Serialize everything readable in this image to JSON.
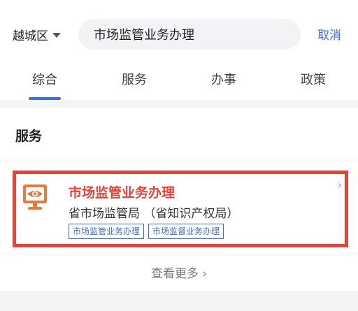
{
  "search_bar": {
    "region": "越城区",
    "query": "市场监管业务办理",
    "cancel_label": "取消"
  },
  "tabs": [
    {
      "label": "综合",
      "active": true
    },
    {
      "label": "服务",
      "active": false
    },
    {
      "label": "办事",
      "active": false
    },
    {
      "label": "政策",
      "active": false
    }
  ],
  "section": {
    "title": "服务"
  },
  "result": {
    "title": "市场监管业务办理",
    "department": "省市场监管局 （省知识产权局）",
    "tags": [
      "市场监管业务办理",
      "市场监督业务办理"
    ],
    "icon": "monitor-eye-icon",
    "chevron": "›"
  },
  "more_label": "查看更多 ›",
  "colors": {
    "accent": "#3b6fd6",
    "highlight": "#e0443a",
    "icon": "#e9793a"
  }
}
